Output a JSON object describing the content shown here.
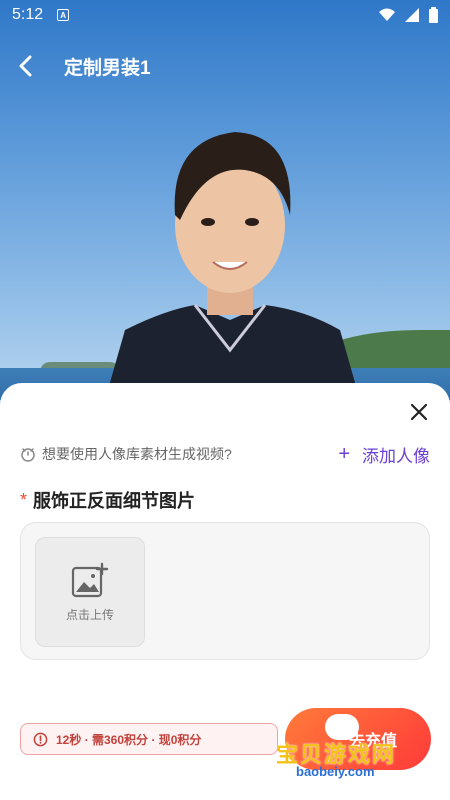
{
  "status_bar": {
    "time": "5:12",
    "indicator": "A"
  },
  "header": {
    "title": "定制男装1"
  },
  "sheet": {
    "hint_text": "想要使用人像库素材生成视频?",
    "add_portrait_plus": "+",
    "add_portrait_label": "添加人像",
    "required_mark": "*",
    "section_title": "服饰正反面细节图片",
    "upload_label": "点击上传",
    "cost_text": "12秒 · 需360积分 · 现0积分",
    "generate_label": "去充值"
  },
  "watermark": {
    "main": "宝贝游戏网",
    "sub": "baobeiy.com"
  },
  "colors": {
    "accent": "#6b3fd6",
    "required": "#e84b3c",
    "cost_text": "#c2423c",
    "button_start": "#ff7b3a",
    "button_end": "#ff3a3a"
  }
}
